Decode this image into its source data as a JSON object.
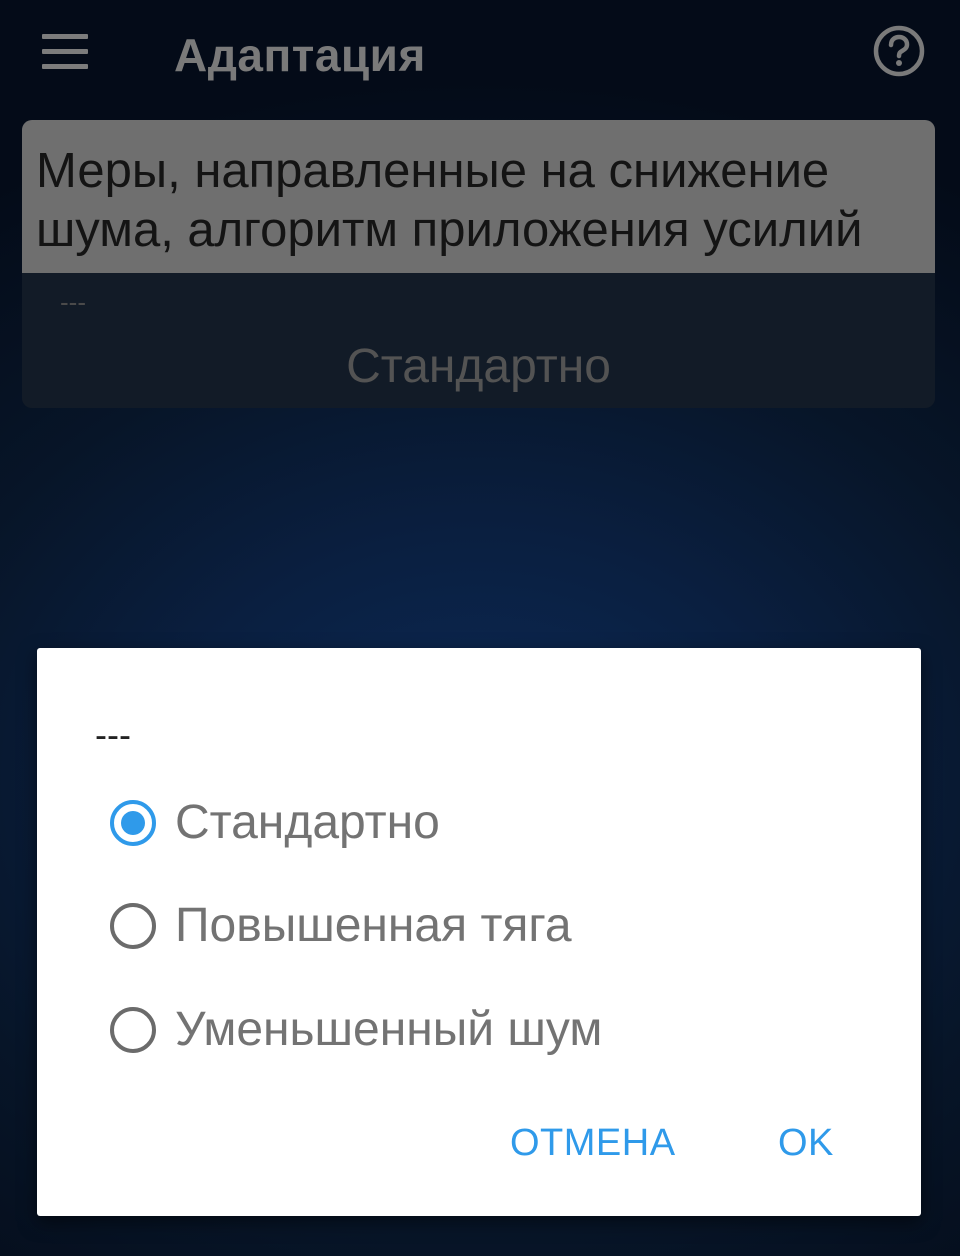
{
  "app_bar": {
    "title": "Адаптация",
    "menu_icon": "hamburger-menu-icon",
    "help_icon": "question-circle-icon"
  },
  "setting_card": {
    "title": "Меры, направленные на снижение\nшума, алгоритм приложения усилий",
    "subtitle": "---",
    "value": "Стандартно"
  },
  "dialog": {
    "title": "---",
    "options": [
      {
        "label": "Стандартно",
        "selected": true
      },
      {
        "label": "Повышенная тяга",
        "selected": false
      },
      {
        "label": "Уменьшенный шум",
        "selected": false
      }
    ],
    "cancel_label": "ОТМЕНА",
    "ok_label": "OK"
  },
  "colors": {
    "accent": "#2f9aea",
    "background": "#071528",
    "card_header": "#6f6f6f"
  }
}
